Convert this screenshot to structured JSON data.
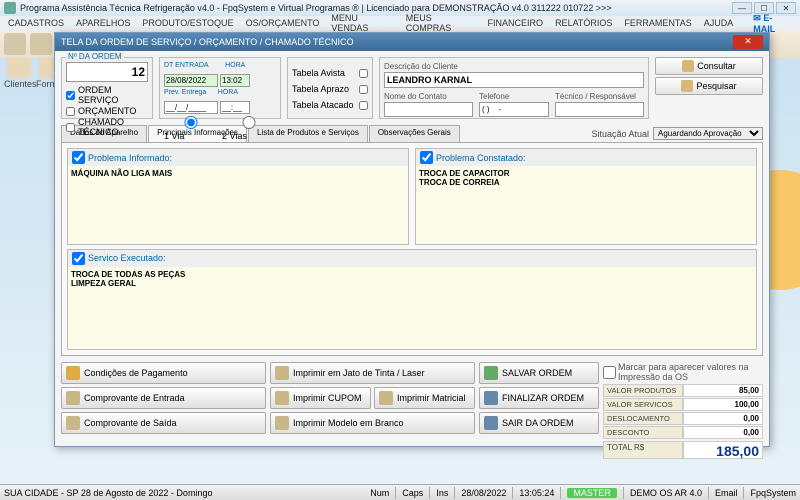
{
  "window": {
    "title": "Programa Assistência Técnica Refrigeração v4.0 - FpqSystem e Virtual Programas ® | Licenciado para  DEMONSTRAÇÃO v4.0 311222 010722 >>>"
  },
  "menu": {
    "items": [
      "CADASTROS",
      "APARELHOS",
      "PRODUTO/ESTOQUE",
      "OS/ORÇAMENTO",
      "MENU VENDAS",
      "MEUS COMPRAS",
      "FINANCEIRO",
      "RELATÓRIOS",
      "FERRAMENTAS",
      "AJUDA"
    ],
    "email": "E-MAIL"
  },
  "quick": {
    "clientes": "Clientes",
    "fornece": "Fornece"
  },
  "dialog": {
    "title": "TELA DA ORDEM DE SERVIÇO / ORÇAMENTO / CHAMADO TÉCNICO",
    "order": {
      "label": "Nº DA ORDEM",
      "num": "12",
      "ordem_servico": "ORDEM SERVIÇO",
      "orcamento": "ORÇAMENTO",
      "chamado": "CHAMADO TÉCNICO"
    },
    "dates": {
      "dt_entrada_lbl": "DT ENTRADA",
      "hora_lbl": "HORA",
      "dt_entrada": "28/08/2022",
      "hora": "13:02",
      "prev_lbl": "Prev. Entrega",
      "prev_hora_lbl": "HORA",
      "prev": "__/__/____",
      "prev_hora": "__:__",
      "via1": "1 Via",
      "via2": "2 Vias"
    },
    "tabela": {
      "avista": "Tabela Avista",
      "aprazo": "Tabela Aprazo",
      "atacado": "Tabela Atacado"
    },
    "cliente": {
      "desc_lbl": "Descrição do Cliente",
      "desc": "LEANDRO KARNAL",
      "contato_lbl": "Nome do Contato",
      "contato": "",
      "tel_lbl": "Telefone",
      "tel": "( )    -",
      "tec_lbl": "Técnico / Responsável",
      "tec": ""
    },
    "buttons": {
      "consultar": "Consultar",
      "pesquisar": "Pesquisar"
    },
    "tabs": {
      "dados": "Dados do Aparelho",
      "principais": "Principais Informações",
      "lista": "Lista de Produtos e Serviços",
      "obs": "Observações Gerais"
    },
    "situacao": {
      "label": "Situação Atual",
      "value": "Aguardando Aprovação"
    },
    "problema_informado": {
      "label": "Problema Informado:",
      "text": "MÁQUINA NÃO LIGA MAIS"
    },
    "problema_constatado": {
      "label": "Problema Constatado:",
      "text": "TROCA DE CAPACITOR\nTROCA DE CORREIA"
    },
    "servico": {
      "label": "Servico Executado:",
      "text": "TROCA DE TODAS AS PEÇAS\nLIMPEZA GERAL"
    },
    "actions": {
      "condicoes": "Condições de Pagamento",
      "jato": "Imprimir em Jato de Tinta / Laser",
      "salvar": "SALVAR ORDEM",
      "comp_entrada": "Comprovante de Entrada",
      "cupom": "Imprimir CUPOM",
      "matricial": "Imprimir Matricial",
      "finalizar": "FINALIZAR ORDEM",
      "comp_saida": "Comprovante de Saída",
      "branco": "Imprimir Modelo em Branco",
      "sair": "SAIR DA ORDEM"
    },
    "totals": {
      "marcar": "Marcar para aparecer valores na Impressão da OS",
      "produtos_lbl": "VALOR PRODUTOS",
      "produtos": "85,00",
      "servicos_lbl": "VALOR SERVICOS",
      "servicos": "100,00",
      "desloc_lbl": "DESLOCAMENTO",
      "desloc": "0,00",
      "desconto_lbl": "DESCONTO",
      "desconto": "0,00",
      "total_lbl": "TOTAL R$",
      "total": "185,00"
    }
  },
  "status": {
    "cidade": "SUA CIDADE - SP 28 de Agosto de 2022 - Domingo",
    "num": "Num",
    "caps": "Caps",
    "ins": "Ins",
    "date": "28/08/2022",
    "time": "13:05:24",
    "master": "MASTER",
    "demo": "DEMO OS AR 4.0",
    "email": "Email",
    "fpq": "FpqSystem"
  }
}
